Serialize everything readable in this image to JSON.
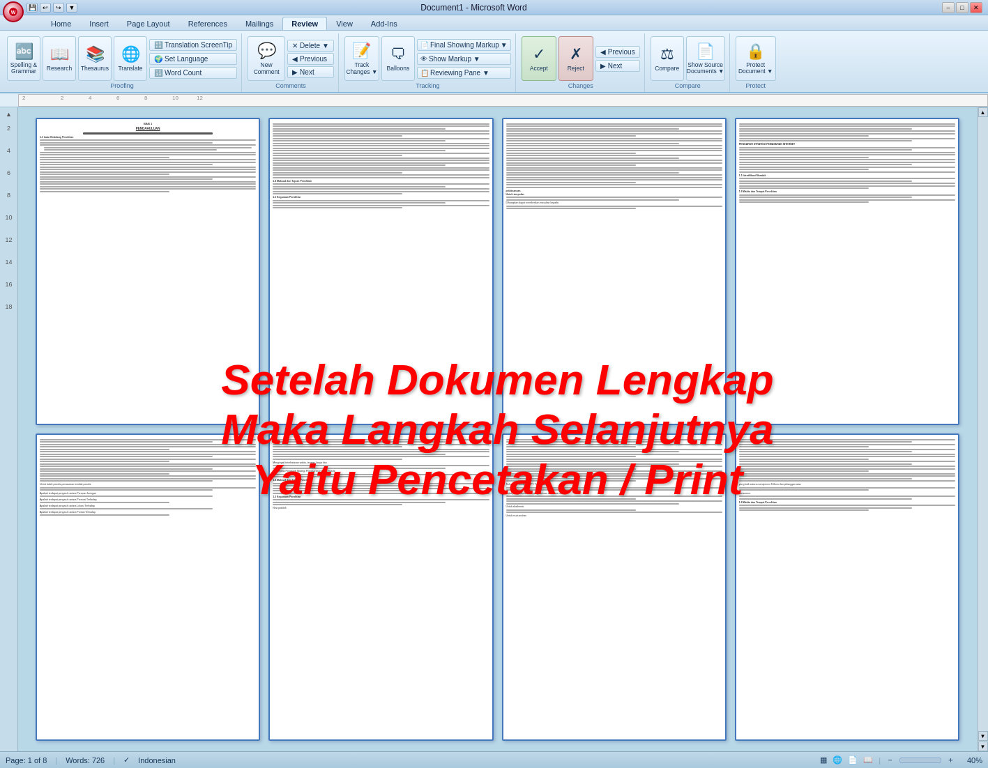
{
  "window": {
    "title": "Document1 - Microsoft Word",
    "min_label": "–",
    "max_label": "□",
    "close_label": "✕"
  },
  "ribbon": {
    "tabs": [
      {
        "id": "home",
        "label": "Home"
      },
      {
        "id": "insert",
        "label": "Insert"
      },
      {
        "id": "pagelayout",
        "label": "Page Layout"
      },
      {
        "id": "references",
        "label": "References"
      },
      {
        "id": "mailings",
        "label": "Mailings"
      },
      {
        "id": "review",
        "label": "Review",
        "active": true
      },
      {
        "id": "view",
        "label": "View"
      },
      {
        "id": "addins",
        "label": "Add-Ins"
      }
    ],
    "groups": {
      "proofing": {
        "label": "Proofing",
        "spelling_label": "Spelling &\nGrammar",
        "research_label": "Research",
        "thesaurus_label": "Thesaurus",
        "translate_label": "Translate",
        "translation_screentip": "Translation ScreenTip",
        "set_language": "Set Language",
        "word_count": "Word Count"
      },
      "comments": {
        "label": "Comments",
        "new_comment": "New\nComment",
        "delete_label": "Delete",
        "previous_label": "Previous",
        "next_label": "Next"
      },
      "tracking": {
        "label": "Tracking",
        "track_changes": "Track\nChanges",
        "balloons_label": "Balloons",
        "final_showing_markup": "Final Showing Markup",
        "show_markup": "Show Markup ▼",
        "reviewing_pane": "Reviewing Pane ▼"
      },
      "changes": {
        "label": "Changes",
        "accept_label": "Accept",
        "reject_label": "Reject",
        "previous_label": "Previous",
        "next_label": "Next"
      },
      "compare": {
        "label": "Compare",
        "compare_label": "Compare",
        "show_source_label": "Show Source\nDocuments ▼"
      },
      "protect": {
        "label": "Protect",
        "protect_document": "Protect\nDocument ▼"
      }
    }
  },
  "overlay": {
    "line1": "Setelah Dokumen  Lengkap",
    "line2": "Maka  Langkah  Selanjutnya",
    "line3": "Yaitu  Pencetakan / Print"
  },
  "statusbar": {
    "page": "Page: 1 of 8",
    "words": "Words: 726",
    "language": "Indonesian",
    "zoom": "40%"
  }
}
